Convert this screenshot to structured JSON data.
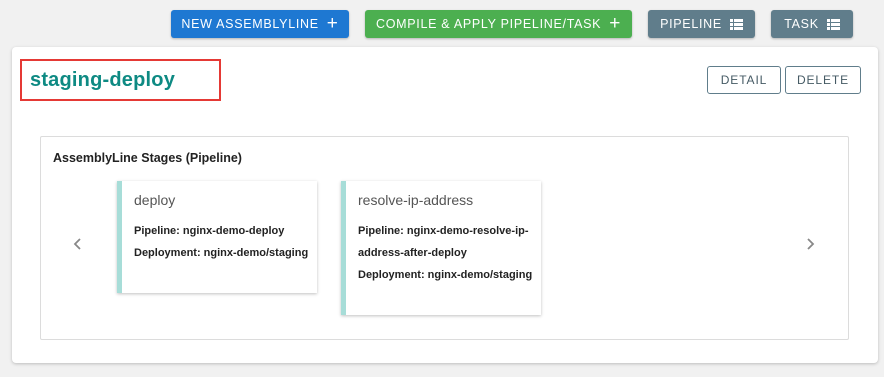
{
  "toolbar": {
    "new_assemblyline": "NEW ASSEMBLYLINE",
    "compile_apply": "COMPILE & APPLY PIPELINE/TASK",
    "pipeline": "PIPELINE",
    "task": "TASK"
  },
  "card": {
    "title": "staging-deploy",
    "detail_button": "DETAIL",
    "delete_button": "DELETE",
    "stages_title": "AssemblyLine Stages (Pipeline)",
    "stages": [
      {
        "name": "deploy",
        "pipeline": "Pipeline: nginx-demo-deploy",
        "deployment": "Deployment: nginx-demo/staging"
      },
      {
        "name": "resolve-ip-address",
        "pipeline": "Pipeline: nginx-demo-resolve-ip-address-after-deploy",
        "deployment": "Deployment: nginx-demo/staging"
      }
    ]
  },
  "colors": {
    "primary_blue": "#1e78d2",
    "success_green": "#4caf50",
    "slate_gray": "#607d8b",
    "title_teal": "#0e8a83",
    "highlight_red": "#e53935",
    "stage_accent": "#a7ddd8"
  },
  "icons": {
    "add": "plus-icon",
    "list": "list-icon",
    "prev": "chevron-left-icon",
    "next": "chevron-right-icon"
  }
}
